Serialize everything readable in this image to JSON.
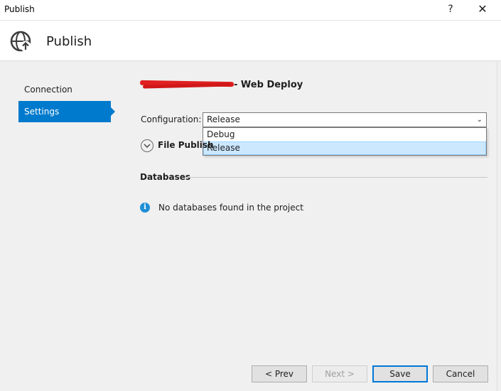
{
  "window": {
    "title": "Publish",
    "help_glyph": "?",
    "close_glyph": "✕"
  },
  "header": {
    "icon": "globe-publish-icon",
    "title": "Publish"
  },
  "nav": {
    "items": [
      {
        "label": "Connection",
        "active": false
      },
      {
        "label": "Settings",
        "active": true
      }
    ]
  },
  "profile": {
    "name_redacted": true,
    "suffix": "- Web Deploy"
  },
  "configuration": {
    "label": "Configuration:",
    "selected": "Release",
    "options": [
      "Debug",
      "Release"
    ],
    "highlighted": "Release"
  },
  "file_publish": {
    "label": "File Publish"
  },
  "databases": {
    "heading": "Databases",
    "message": "No databases found in the project",
    "info_glyph": "i"
  },
  "buttons": {
    "prev": "< Prev",
    "next": "Next >",
    "save": "Save",
    "cancel": "Cancel"
  },
  "colors": {
    "accent": "#007acc",
    "info": "#1e8fd6",
    "selection": "#cce8ff",
    "redaction": "#e02020"
  }
}
